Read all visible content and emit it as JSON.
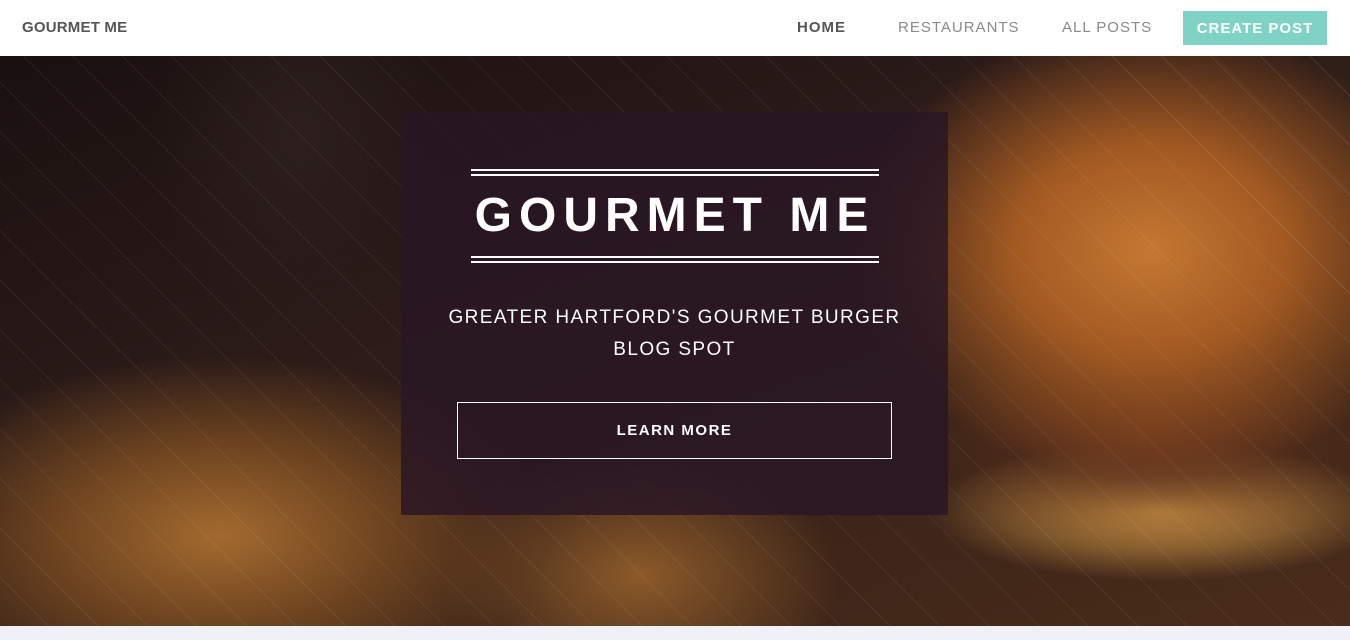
{
  "navbar": {
    "brand": "GOURMET ME",
    "links": [
      {
        "label": "HOME",
        "active": true
      },
      {
        "label": "RESTAURANTS",
        "active": false
      },
      {
        "label": "ALL POSTS",
        "active": false
      }
    ],
    "create_post_label": "CREATE POST"
  },
  "hero": {
    "title": "GOURMET ME",
    "subtitle_line1": "GREATER HARTFORD'S GOURMET BURGER",
    "subtitle_line2": "BLOG SPOT",
    "button_label": "LEARN MORE",
    "background_image": "burger-and-fries-photo"
  },
  "colors": {
    "accent": "#7fd3c4",
    "overlay_box": "#281624",
    "nav_text": "#555555",
    "nav_text_muted": "#8a8a8a"
  }
}
